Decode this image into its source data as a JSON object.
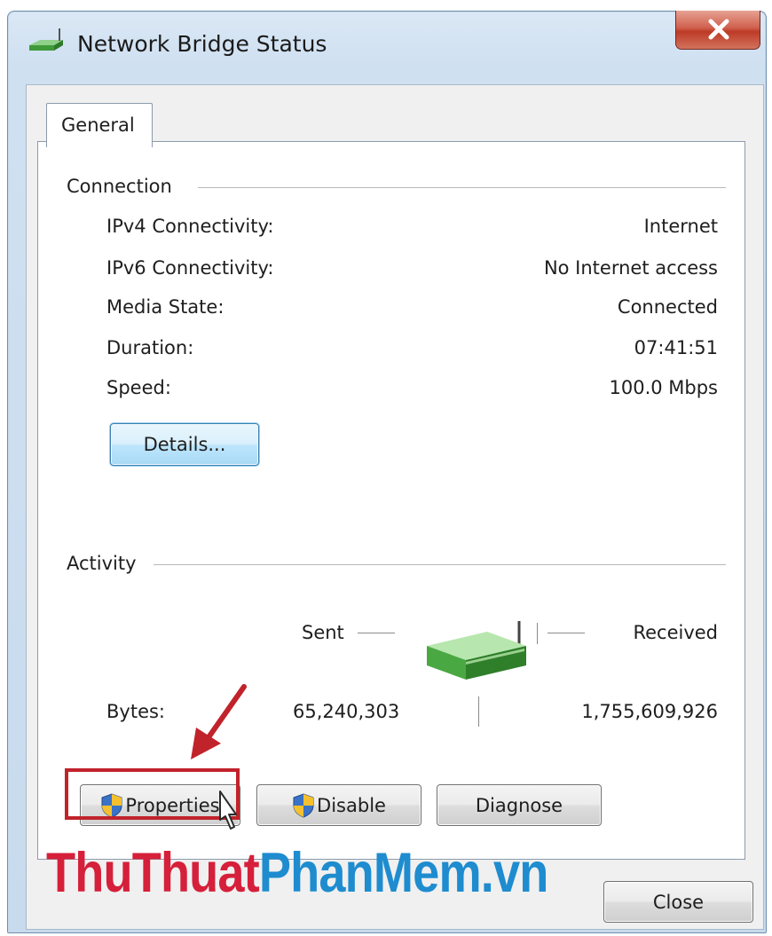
{
  "window": {
    "title": "Network Bridge Status"
  },
  "tabs": [
    {
      "label": "General",
      "selected": true
    }
  ],
  "connection": {
    "heading": "Connection",
    "rows": [
      {
        "label": "IPv4 Connectivity:",
        "value": "Internet"
      },
      {
        "label": "IPv6 Connectivity:",
        "value": "No Internet access"
      },
      {
        "label": "Media State:",
        "value": "Connected"
      },
      {
        "label": "Duration:",
        "value": "07:41:51"
      },
      {
        "label": "Speed:",
        "value": "100.0 Mbps"
      }
    ],
    "details_button": "Details..."
  },
  "activity": {
    "heading": "Activity",
    "sent_label": "Sent",
    "received_label": "Received",
    "bytes_label": "Bytes:",
    "bytes_sent": "65,240,303",
    "bytes_received": "1,755,609,926"
  },
  "buttons": {
    "properties": "Properties",
    "disable": "Disable",
    "diagnose": "Diagnose",
    "close": "Close"
  },
  "watermark": {
    "part1": "ThuThuat",
    "part2": "PhanMem.vn"
  },
  "colors": {
    "highlight": "#c1232b",
    "watermark_red": "#d61f3a",
    "watermark_blue": "#1e8ccf",
    "close_button_red": "#c84a36"
  },
  "icons": {
    "title": "network-adapter-icon",
    "activity": "network-adapter-icon",
    "uac": "uac-shield-icon",
    "cursor": "mouse-pointer-icon",
    "annotation": "red-arrow-icon"
  }
}
